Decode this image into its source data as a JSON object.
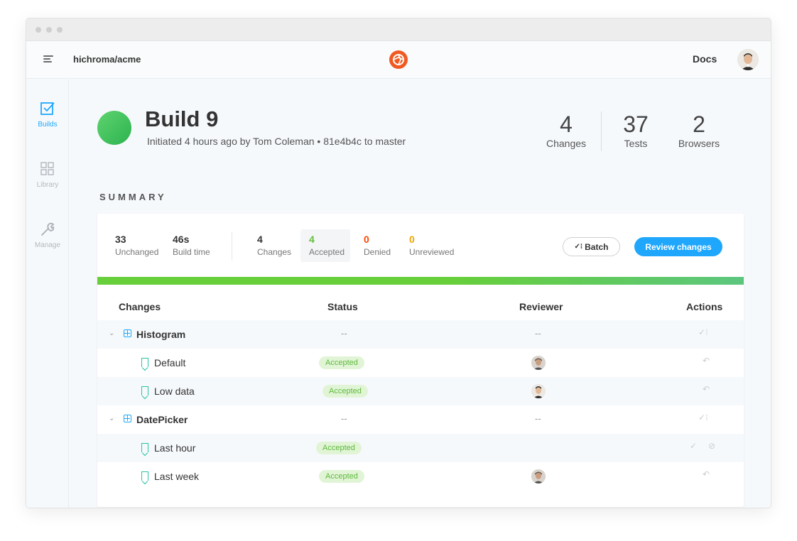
{
  "window": {
    "dots": 3
  },
  "topnav": {
    "repo": "hichroma/acme",
    "docs_label": "Docs"
  },
  "sidebar": {
    "items": [
      {
        "label": "Builds",
        "icon": "checkbox-icon",
        "active": true
      },
      {
        "label": "Library",
        "icon": "grid-icon",
        "active": false
      },
      {
        "label": "Manage",
        "icon": "wrench-icon",
        "active": false
      }
    ]
  },
  "build": {
    "title": "Build 9",
    "subtitle": "Initiated 4 hours ago by Tom Coleman • 81e4b4c to master",
    "stats": [
      {
        "value": "4",
        "label": "Changes"
      },
      {
        "value": "37",
        "label": "Tests"
      },
      {
        "value": "2",
        "label": "Browsers"
      }
    ]
  },
  "summary": {
    "heading": "SUMMARY",
    "metrics": [
      {
        "value": "33",
        "label": "Unchanged"
      },
      {
        "value": "46s",
        "label": "Build time"
      },
      {
        "value": "4",
        "label": "Changes"
      },
      {
        "value": "4",
        "label": "Accepted"
      },
      {
        "value": "0",
        "label": "Denied"
      },
      {
        "value": "0",
        "label": "Unreviewed"
      }
    ],
    "batch_label": "Batch",
    "review_label": "Review changes",
    "progress_accepted_fraction": 1.0
  },
  "table": {
    "headers": {
      "changes": "Changes",
      "status": "Status",
      "reviewer": "Reviewer",
      "actions": "Actions"
    },
    "rows": [
      {
        "kind": "group",
        "name": "Histogram",
        "status": "--",
        "reviewer": "--"
      },
      {
        "kind": "story",
        "name": "Default",
        "status": "Accepted"
      },
      {
        "kind": "story",
        "name": "Low data",
        "status": "Accepted"
      },
      {
        "kind": "group",
        "name": "DatePicker",
        "status": "--",
        "reviewer": "--"
      },
      {
        "kind": "story",
        "name": "Last hour",
        "status": "Accepted"
      },
      {
        "kind": "story",
        "name": "Last week",
        "status": "Accepted"
      }
    ]
  },
  "colors": {
    "accent": "#1ea7fd",
    "accepted": "#66bf3c",
    "denied": "#ff4400",
    "unreviewed": "#f0a400",
    "logo": "#f05a22"
  }
}
